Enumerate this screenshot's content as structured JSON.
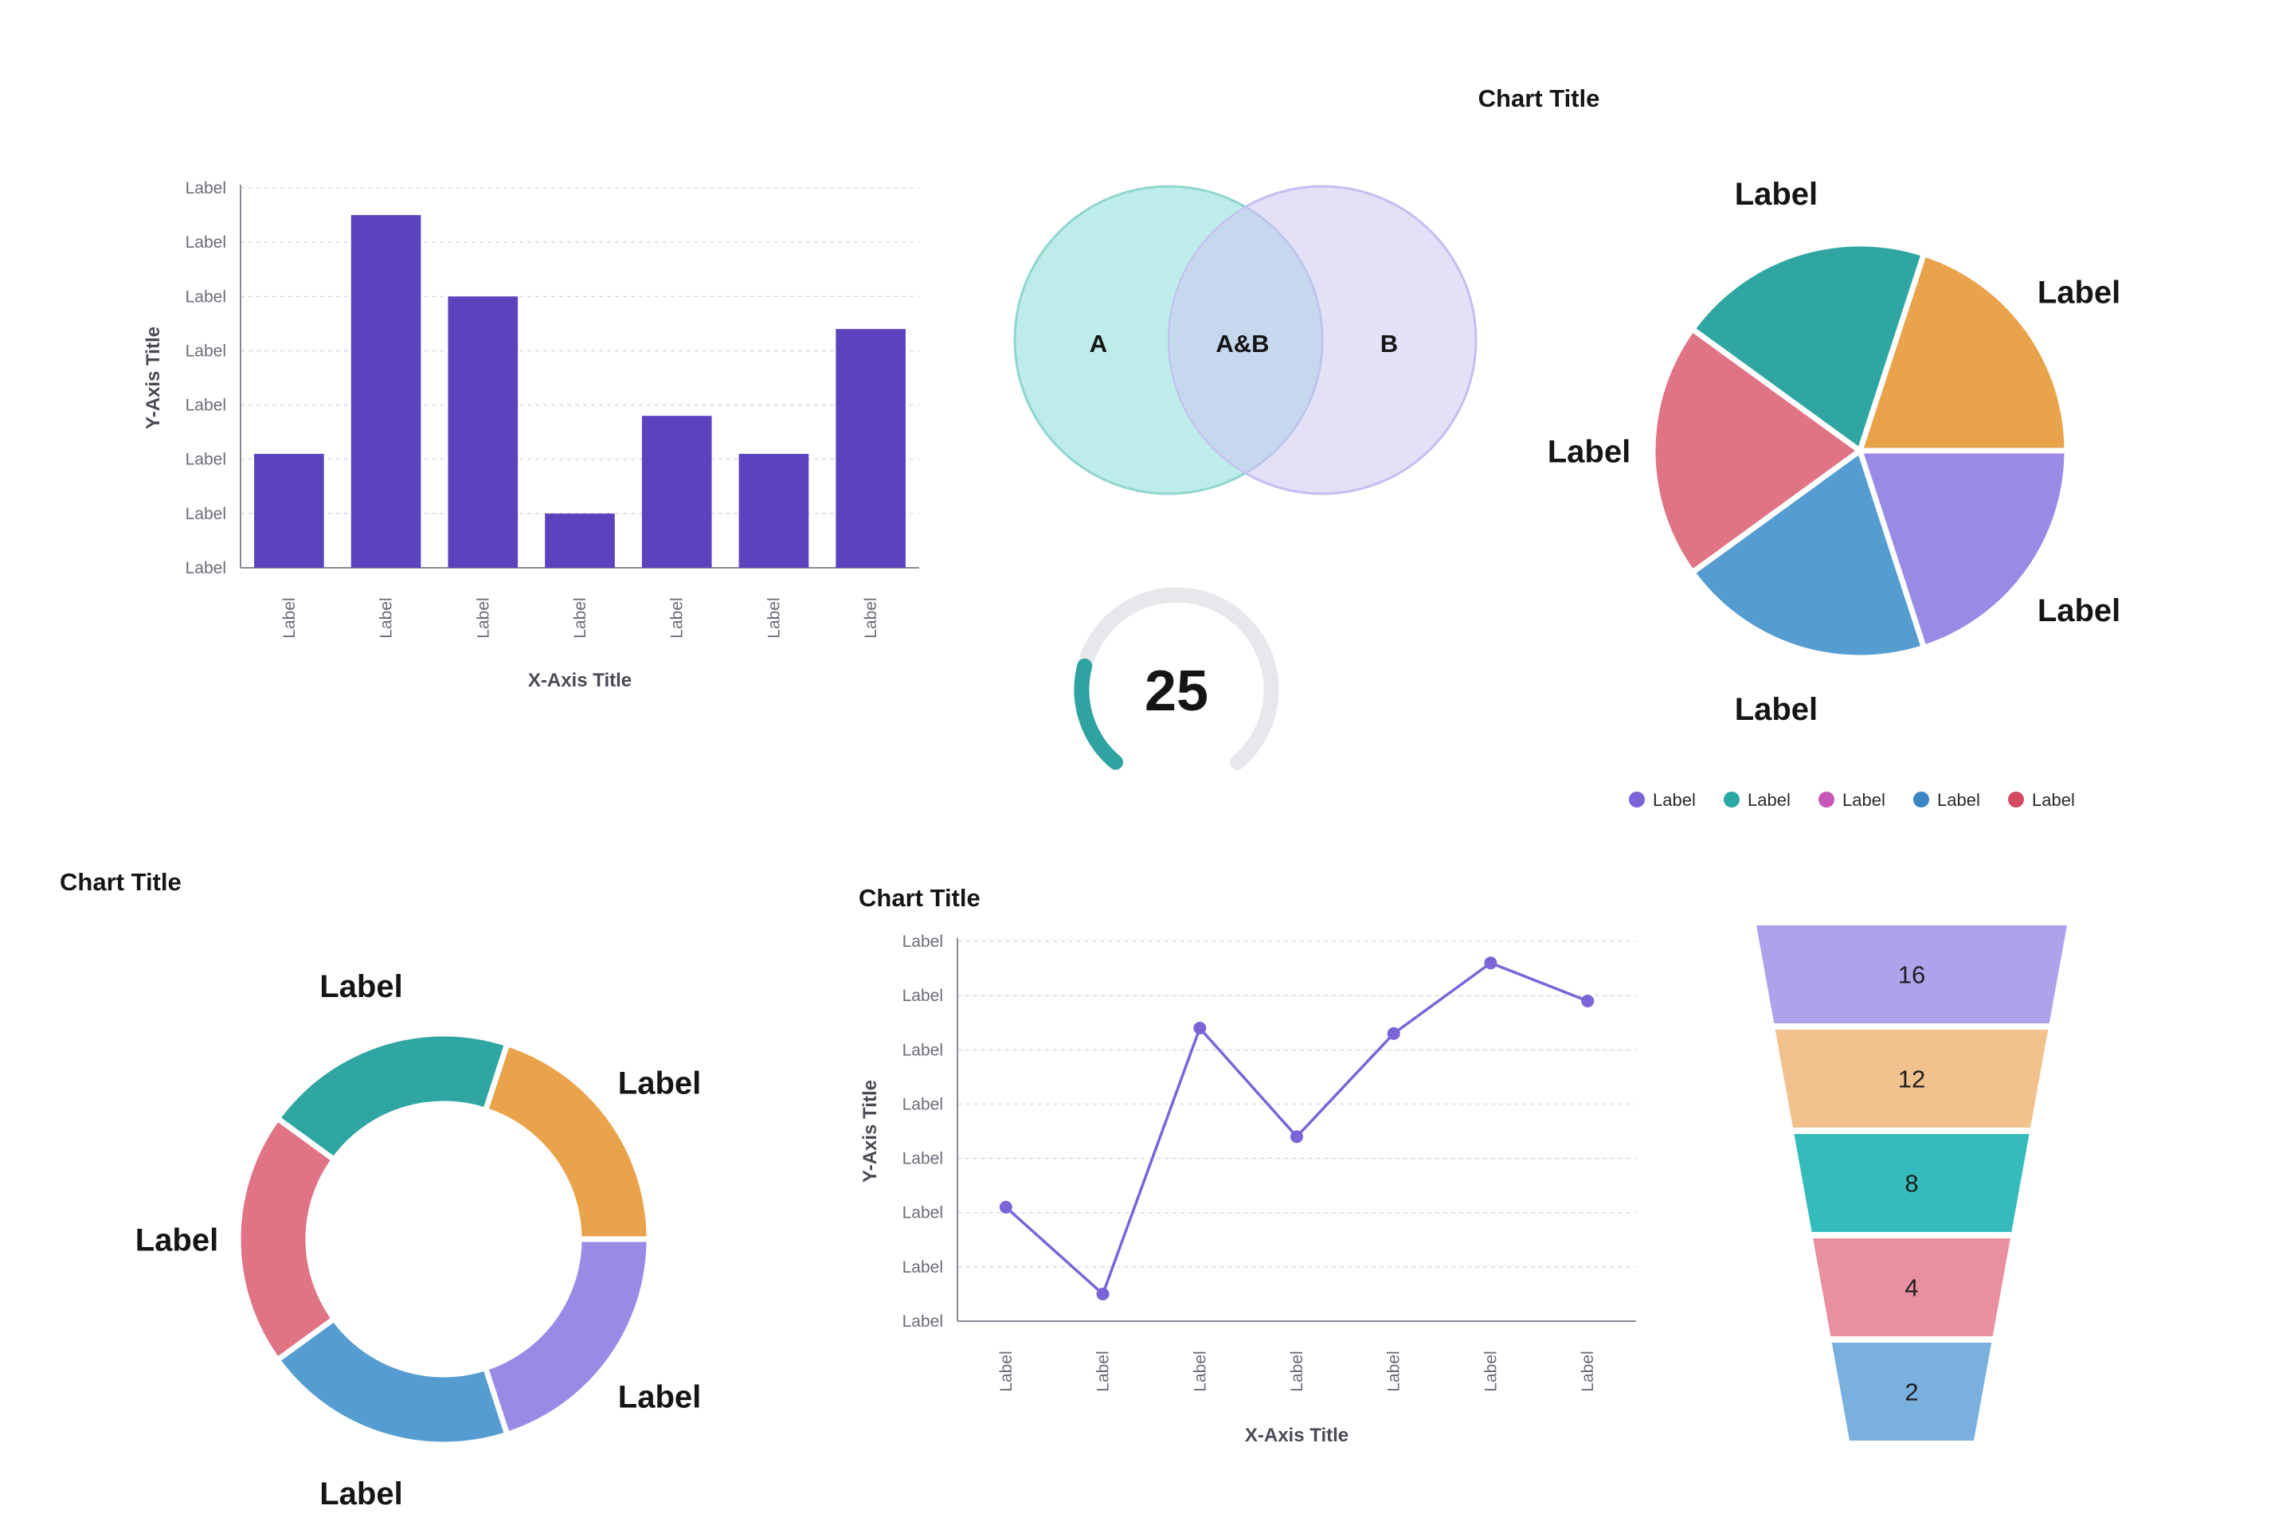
{
  "colors": {
    "bar": "#5b43be",
    "line": "#7b64d8",
    "grid": "#dcdde3",
    "axis": "#8a8a96",
    "tick_text": "#6b6b78",
    "axis_title": "#4a4a55",
    "title": "#151515",
    "venn_a_fill": "#bdecea",
    "venn_a_stroke": "#8fd6cf",
    "venn_b_fill": "#e4e0f8",
    "venn_b_stroke": "#c6bdf0",
    "venn_overlap": "#c6d8ee",
    "gauge_track": "#e7e8ec",
    "gauge_fill": "#2fa3a1"
  },
  "gauge": {
    "value": "25",
    "fraction": 0.23
  },
  "chart_data": [
    {
      "type": "bar",
      "title": "",
      "xlabel": "X-Axis Title",
      "ylabel": "Y-Axis Title",
      "ytick_labels": [
        "Label",
        "Label",
        "Label",
        "Label",
        "Label",
        "Label",
        "Label",
        "Label"
      ],
      "categories": [
        "Label",
        "Label",
        "Label",
        "Label",
        "Label",
        "Label",
        "Label"
      ],
      "values": [
        2.1,
        6.5,
        5.0,
        1.0,
        2.8,
        2.1,
        4.4
      ],
      "ylim": [
        0,
        7
      ],
      "grid": true
    },
    {
      "type": "venn",
      "title": "",
      "sets": [
        {
          "label": "A"
        },
        {
          "label": "B"
        }
      ],
      "intersection_label": "A&B"
    },
    {
      "type": "pie",
      "title": "Chart Title",
      "slices": [
        {
          "label": "Label",
          "value": 20,
          "color": "#e9a34a"
        },
        {
          "label": "Label",
          "value": 20,
          "color": "#9b89e6"
        },
        {
          "label": "Label",
          "value": 20,
          "color": "#559cd0"
        },
        {
          "label": "Label",
          "value": 20,
          "color": "#e07485"
        },
        {
          "label": "Label",
          "value": 20,
          "color": "#30a6a2"
        }
      ],
      "legend": [
        {
          "label": "Label",
          "color": "#7a63d8"
        },
        {
          "label": "Label",
          "color": "#2aa8a4"
        },
        {
          "label": "Label",
          "color": "#c657b8"
        },
        {
          "label": "Label",
          "color": "#3d86c4"
        },
        {
          "label": "Label",
          "color": "#d24b63"
        }
      ],
      "legend_position": "bottom"
    },
    {
      "type": "donut",
      "title": "Chart Title",
      "slices": [
        {
          "label": "Label",
          "value": 20,
          "color": "#e9a34a"
        },
        {
          "label": "Label",
          "value": 20,
          "color": "#9b89e6"
        },
        {
          "label": "Label",
          "value": 20,
          "color": "#559cd0"
        },
        {
          "label": "Label",
          "value": 20,
          "color": "#e07485"
        },
        {
          "label": "Label",
          "value": 20,
          "color": "#30a6a2"
        }
      ]
    },
    {
      "type": "line",
      "title": "Chart Title",
      "xlabel": "X-Axis Title",
      "ylabel": "Y-Axis Title",
      "ytick_labels": [
        "Label",
        "Label",
        "Label",
        "Label",
        "Label",
        "Label",
        "Label",
        "Label"
      ],
      "categories": [
        "Label",
        "Label",
        "Label",
        "Label",
        "Label",
        "Label",
        "Label"
      ],
      "values": [
        2.1,
        0.5,
        5.4,
        3.4,
        5.3,
        6.6,
        5.9
      ],
      "ylim": [
        0,
        7
      ],
      "grid": true
    },
    {
      "type": "funnel",
      "title": "",
      "stages": [
        {
          "value": 16,
          "label": "16",
          "color": "#ada3ea"
        },
        {
          "value": 12,
          "label": "12",
          "color": "#f1c28e"
        },
        {
          "value": 8,
          "label": "8",
          "color": "#34bcbc"
        },
        {
          "value": 4,
          "label": "4",
          "color": "#e8909f"
        },
        {
          "value": 2,
          "label": "2",
          "color": "#79b0de"
        }
      ]
    }
  ]
}
